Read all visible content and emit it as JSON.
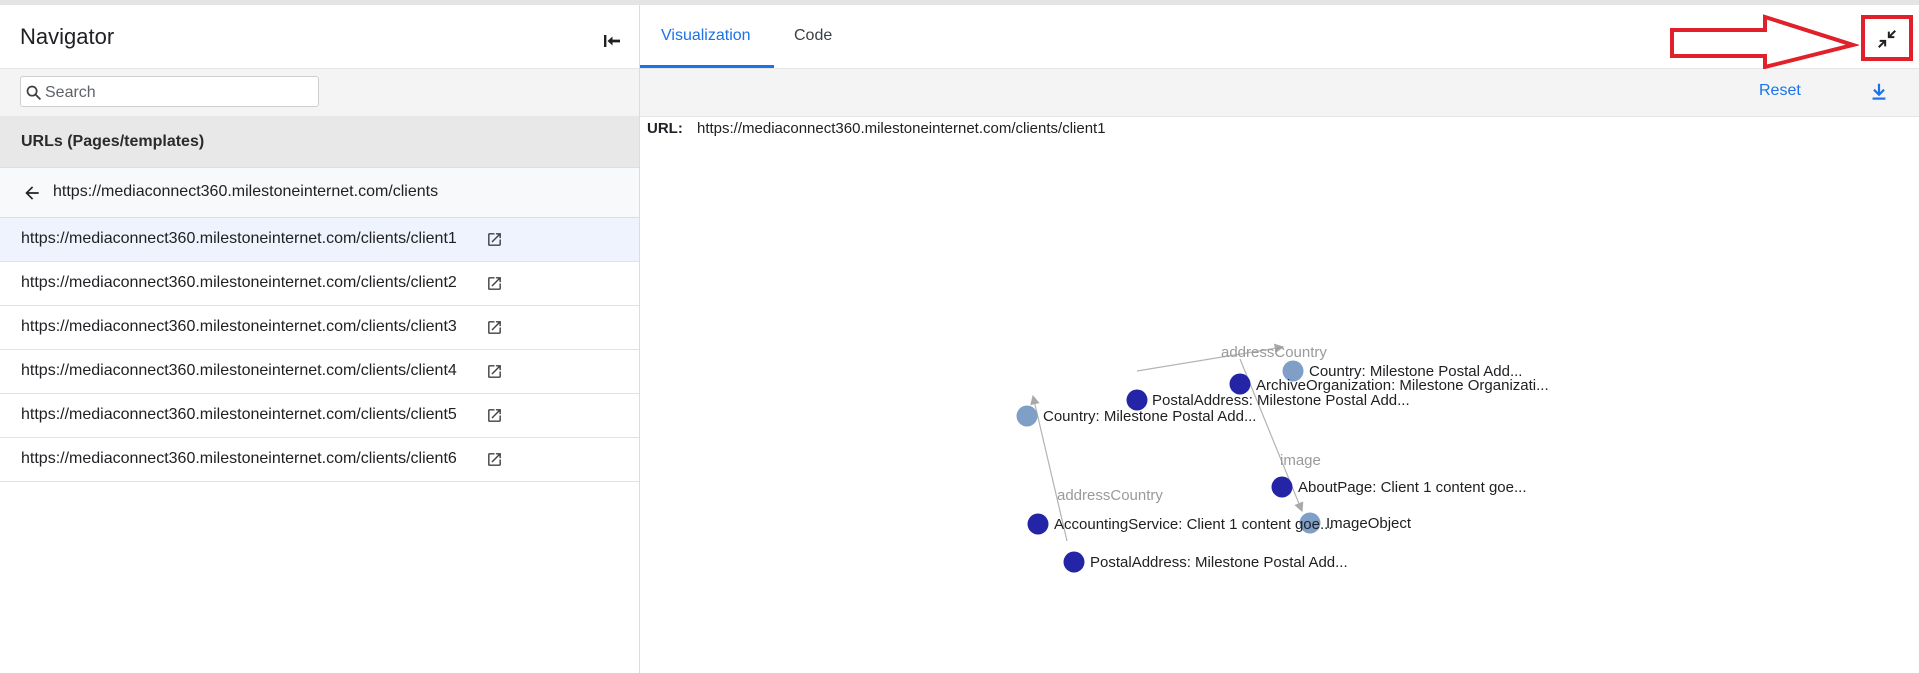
{
  "navigator": {
    "title": "Navigator",
    "search_placeholder": "Search",
    "section_title": "URLs (Pages/templates)",
    "parent_url": "https://mediaconnect360.milestoneinternet.com/clients",
    "urls": [
      "https://mediaconnect360.milestoneinternet.com/clients/client1",
      "https://mediaconnect360.milestoneinternet.com/clients/client2",
      "https://mediaconnect360.milestoneinternet.com/clients/client3",
      "https://mediaconnect360.milestoneinternet.com/clients/client4",
      "https://mediaconnect360.milestoneinternet.com/clients/client5",
      "https://mediaconnect360.milestoneinternet.com/clients/client6"
    ],
    "active_index": 0
  },
  "main": {
    "tabs": [
      "Visualization",
      "Code"
    ],
    "active_tab": "Visualization",
    "reset_label": "Reset",
    "url_label": "URL:",
    "url_value": "https://mediaconnect360.milestoneinternet.com/clients/client1"
  },
  "icons": {
    "collapse": "collapse-left-icon",
    "search": "search-icon",
    "back": "arrow-left-icon",
    "external": "external-link-icon",
    "exit_fullscreen": "exit-fullscreen-icon",
    "download": "download-icon"
  },
  "colors": {
    "accent": "#1a73e8",
    "node_dark": "#2325a6",
    "node_light": "#7f9fc6",
    "annotation": "#e0202a"
  },
  "graph": {
    "nodes": [
      {
        "id": "n1",
        "label": "Country: Milestone Postal Add...",
        "kind": "light"
      },
      {
        "id": "n2",
        "label": "ArchiveOrganization: Milestone Organizati...",
        "kind": "dark"
      },
      {
        "id": "n3",
        "label": "PostalAddress: Milestone Postal Add...",
        "kind": "dark"
      },
      {
        "id": "n4",
        "label": "Country: Milestone Postal Add...",
        "kind": "light"
      },
      {
        "id": "n5",
        "label": "AboutPage: Client 1 content goe...",
        "kind": "dark"
      },
      {
        "id": "n6",
        "label": "AccountingService: Client 1 content goe...",
        "kind": "dark"
      },
      {
        "id": "n7",
        "label": "ImageObject",
        "kind": "light"
      },
      {
        "id": "n8",
        "label": "PostalAddress: Milestone Postal Add...",
        "kind": "dark"
      }
    ],
    "edges": [
      {
        "from": "n3",
        "to": "n1",
        "label": "addressCountry"
      },
      {
        "from": "n2",
        "to": "n7",
        "label": "image"
      },
      {
        "from": "n8",
        "to": "n4",
        "label": "addressCountry"
      }
    ]
  }
}
